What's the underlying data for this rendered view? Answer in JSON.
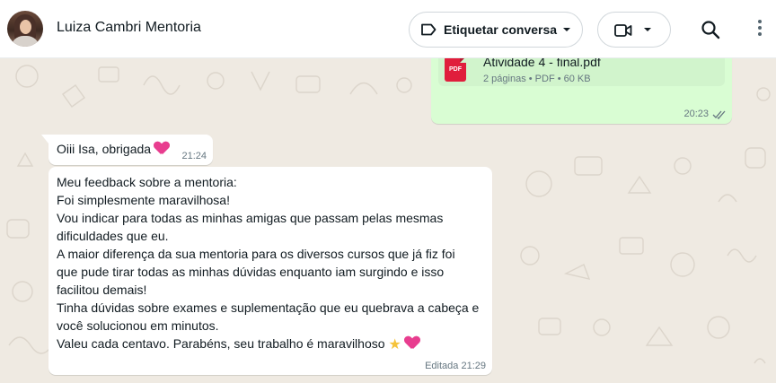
{
  "header": {
    "contact_name": "Luiza Cambri Mentoria",
    "tag_button_label": "Etiquetar conversa",
    "icons": [
      "label-icon",
      "chevron-down-icon",
      "video-camera-icon",
      "search-icon",
      "more-vertical-icon"
    ]
  },
  "outgoing_document": {
    "file_name": "Atividade 4 - final.pdf",
    "meta": "2 páginas • PDF • 60 KB",
    "file_type_label": "PDF",
    "time": "20:23",
    "status": "read"
  },
  "messages": [
    {
      "text": "Oiii Isa, obrigada",
      "emoji": "pink-heart",
      "time": "21:24"
    },
    {
      "lines": [
        "Meu feedback sobre a mentoria:",
        "Foi simplesmente maravilhosa!",
        "Vou indicar para todas as minhas amigas que passam pelas mesmas",
        "dificuldades que eu.",
        "A maior diferença da sua mentoria para os diversos cursos que já fiz foi",
        "que pude tirar todas as minhas dúvidas enquanto iam surgindo e isso",
        "facilitou demais!",
        "Tinha dúvidas sobre exames e suplementação que eu quebrava a cabeça e",
        "você solucionou em minutos.",
        "Valeu cada centavo. Parabéns, seu trabalho é maravilhoso"
      ],
      "emojis": [
        "glowing-star",
        "pink-heart"
      ],
      "edited_label": "Editada",
      "time": "21:29"
    }
  ],
  "colors": {
    "chat_background": "#efeae2",
    "outgoing_bubble": "#d9fdd3",
    "incoming_bubble": "#ffffff",
    "pdf_red": "#e01e3c",
    "heart_pink": "#e83d8f"
  }
}
